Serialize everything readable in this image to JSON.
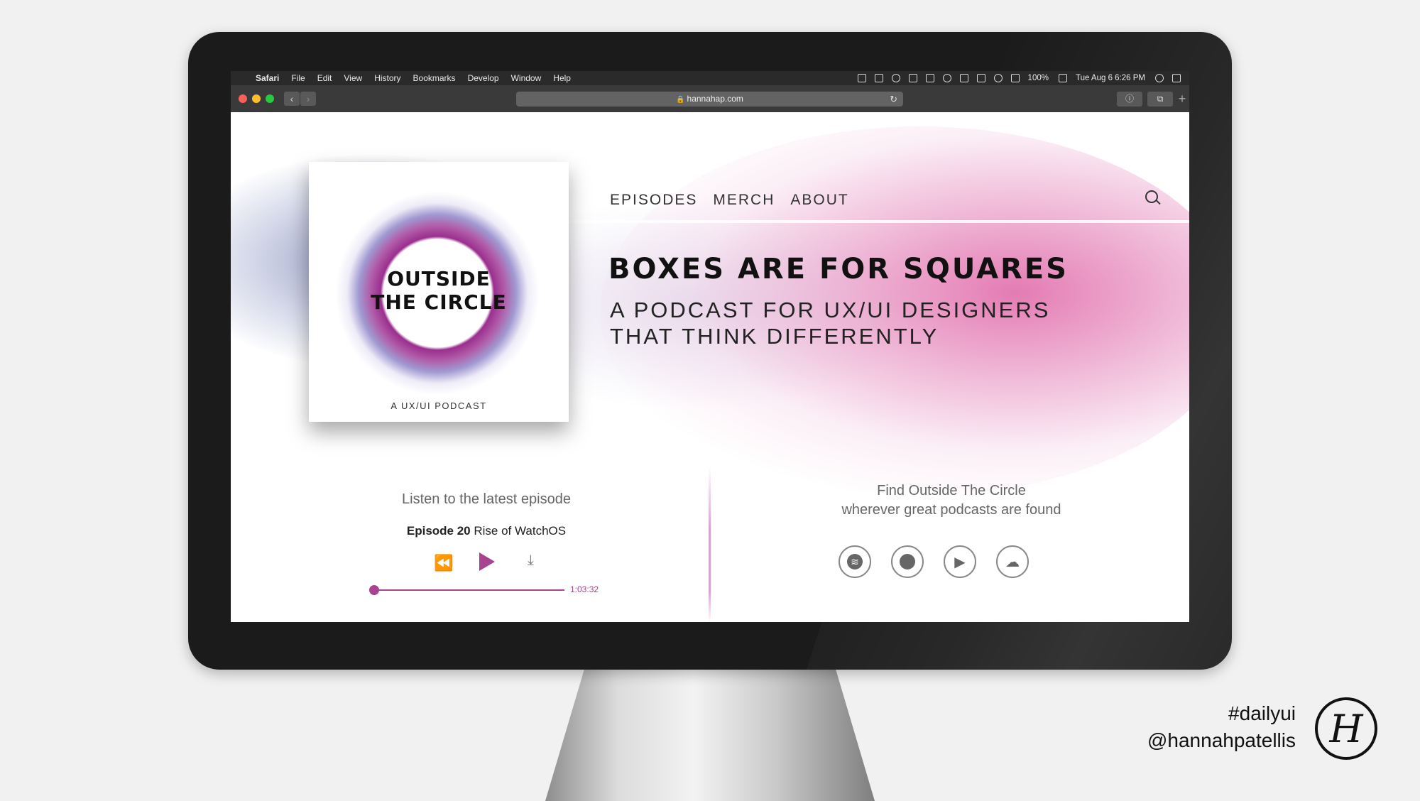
{
  "menubar": {
    "apple": "",
    "items": [
      "Safari",
      "File",
      "Edit",
      "View",
      "History",
      "Bookmarks",
      "Develop",
      "Window",
      "Help"
    ],
    "battery": "100%",
    "datetime": "Tue Aug 6  6:26 PM"
  },
  "toolbar": {
    "url": "hannahap.com"
  },
  "cover": {
    "title_line1": "OUTSIDE",
    "title_line2": "THE CIRCLE",
    "subtitle": "A UX/UI PODCAST"
  },
  "nav": {
    "items": [
      "EPISODES",
      "MERCH",
      "ABOUT"
    ]
  },
  "hero": {
    "headline": "BOXES ARE FOR SQUARES",
    "subhead_line1": "A PODCAST FOR UX/UI DESIGNERS",
    "subhead_line2": "THAT THINK DIFFERENTLY"
  },
  "player": {
    "title": "Listen to the latest episode",
    "episode_number": "Episode 20",
    "episode_name": "Rise of WatchOS",
    "duration": "1:03:32",
    "progress": 0.0
  },
  "platforms": {
    "title_line1": "Find Outside The Circle",
    "title_line2": "wherever great podcasts are found",
    "icons": [
      "spotify-icon",
      "apple-podcasts-icon",
      "google-play-icon",
      "soundcloud-icon"
    ]
  },
  "brand": {
    "hashtag": "#dailyui",
    "handle": "@hannahpatellis",
    "monogram": "H"
  },
  "colors": {
    "accent": "#a8438f",
    "pink_glow": "#dd5aa0",
    "blue_glow": "#6e78af"
  }
}
